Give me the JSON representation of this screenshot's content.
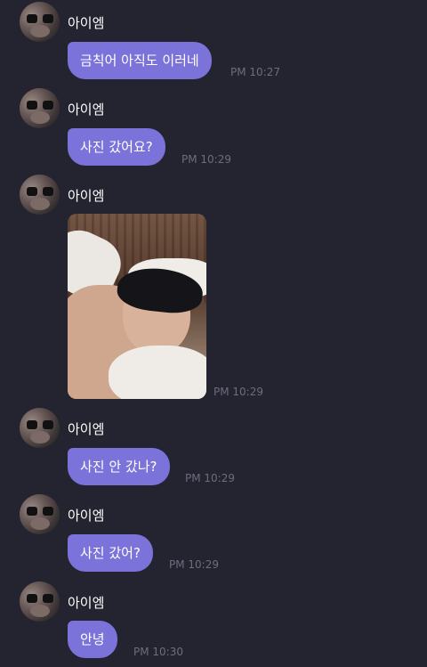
{
  "chat": {
    "sender_name": "아이엠",
    "messages": [
      {
        "text": "금칙어 아직도 이러네",
        "time": "PM 10:27"
      },
      {
        "text": "사진 갔어요?",
        "time": "PM 10:29"
      },
      {
        "text": "",
        "time": "PM 10:29",
        "attachment": "photo"
      },
      {
        "text": "사진 안 갔나?",
        "time": "PM 10:29"
      },
      {
        "text": "사진 갔어?",
        "time": "PM 10:29"
      },
      {
        "text": "안녕",
        "time": "PM 10:30"
      }
    ]
  },
  "colors": {
    "background": "#242330",
    "bubble": "#7b73d9",
    "timestamp": "#6e6c7e",
    "text": "#ffffff"
  }
}
